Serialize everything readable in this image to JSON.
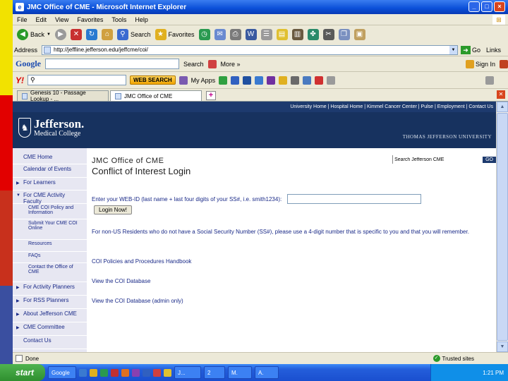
{
  "window": {
    "title": "JMC Office of CME - Microsoft Internet Explorer"
  },
  "menu": [
    "File",
    "Edit",
    "View",
    "Favorites",
    "Tools",
    "Help"
  ],
  "toolbar": {
    "back": "Back",
    "search": "Search",
    "favorites": "Favorites"
  },
  "address": {
    "label": "Address",
    "url": "http://jeffline.jefferson.edu/jeffcme/coi/",
    "go": "Go",
    "links": "Links"
  },
  "google": {
    "logo": "Google",
    "search_label": "Search",
    "more": "More »",
    "signin": "Sign In"
  },
  "yahoo": {
    "logo": "Y!",
    "web_search": "WEB SEARCH",
    "my_apps": "My Apps"
  },
  "tabs": [
    {
      "label": "Genesis 10 - Passage Lookup - ..."
    },
    {
      "label": "JMC Office of CME"
    }
  ],
  "site": {
    "top_links": "University Home | Hospital Home | Kimmel Cancer Center | Pulse | Employment | Contact Us",
    "logo_name": "Jefferson.",
    "logo_sub": "Medical College",
    "university": "THOMAS JEFFERSON UNIVERSITY",
    "search_placeholder": "Search Jefferson CME",
    "search_go": "GO"
  },
  "nav": [
    {
      "label": "CME Home",
      "arrow": "",
      "level": 1
    },
    {
      "label": "Calendar of Events",
      "arrow": "",
      "level": 1
    },
    {
      "label": "For Learners",
      "arrow": "▶",
      "level": 1
    },
    {
      "label": "For CME Activity Faculty",
      "arrow": "▼",
      "level": 1
    },
    {
      "label": "CME COI Policy and Information",
      "arrow": "",
      "level": 2
    },
    {
      "label": "Submit Your CME COI Online",
      "arrow": "",
      "level": 2
    },
    {
      "label": "Resources",
      "arrow": "",
      "level": 2
    },
    {
      "label": "FAQs",
      "arrow": "",
      "level": 2
    },
    {
      "label": "Contact the Office of CME",
      "arrow": "",
      "level": 2
    },
    {
      "label": "For Activity Planners",
      "arrow": "▶",
      "level": 1
    },
    {
      "label": "For RSS Planners",
      "arrow": "▶",
      "level": 1
    },
    {
      "label": "About Jefferson CME",
      "arrow": "▶",
      "level": 1
    },
    {
      "label": "CME Committee",
      "arrow": "▶",
      "level": 1
    },
    {
      "label": "Contact Us",
      "arrow": "",
      "level": 1
    }
  ],
  "content": {
    "heading1": "JMC Office of CME",
    "heading2": "Conflict of Interest Login",
    "login_prompt": "Enter your WEB-ID (last name + last four digits of your SS#, i.e. smith1234):",
    "login_button": "Login Now!",
    "non_us_text": "For non-US Residents who do not have a Social Security Number (SS#), please use a 4-digit number that is specific to you and that you will remember.",
    "link1": "COI Policies and Procedures Handbook",
    "link2": "View the COI Database",
    "link3": "View the COI Database (admin only)"
  },
  "status": {
    "text": "Done",
    "zone": "Trusted sites"
  },
  "taskbar": {
    "start": "start",
    "items": [
      "Google",
      "J...",
      "2",
      "M.",
      "A."
    ],
    "clock": "1:21 PM"
  },
  "colors": {
    "stripe": [
      "#f2e200",
      "#e20000",
      "#c8301c",
      "#3a4fa0"
    ],
    "header": "#17325f",
    "nav_bg": "#e7e7f2",
    "link": "#1a2a88"
  }
}
